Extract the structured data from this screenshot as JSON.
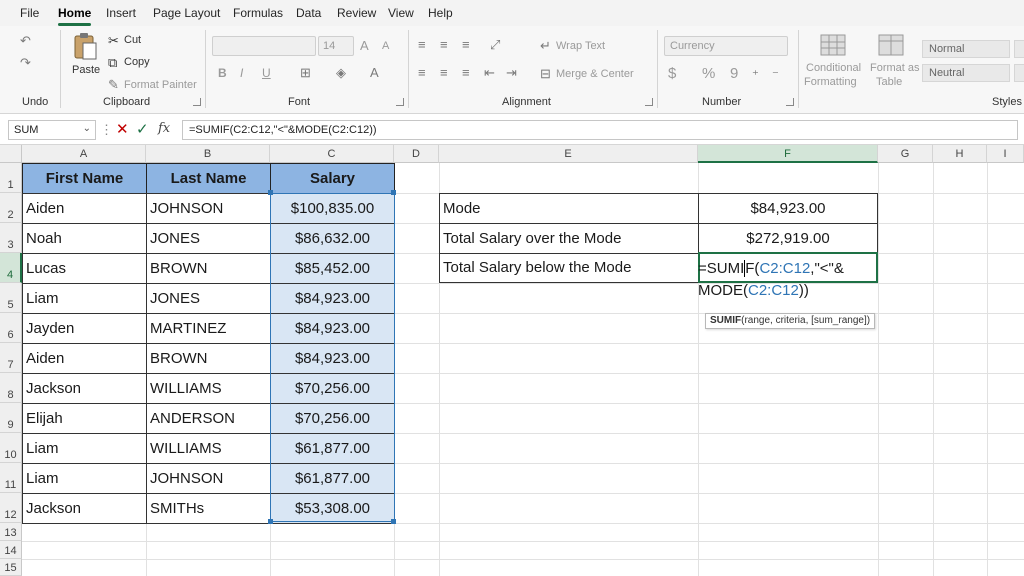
{
  "tabs": [
    "File",
    "Home",
    "Insert",
    "Page Layout",
    "Formulas",
    "Data",
    "Review",
    "View",
    "Help"
  ],
  "active_tab": "Home",
  "ribbon": {
    "undo_group": "Undo",
    "clipboard": {
      "paste": "Paste",
      "cut": "Cut",
      "copy": "Copy",
      "format_painter": "Format Painter",
      "label": "Clipboard"
    },
    "font": {
      "size": "14",
      "bold": "B",
      "italic": "I",
      "underline": "U",
      "grow": "A",
      "shrink": "A",
      "label": "Font"
    },
    "alignment": {
      "wrap": "Wrap Text",
      "merge": "Merge & Center",
      "label": "Alignment"
    },
    "number": {
      "format": "Currency",
      "dollar": "$",
      "percent": "%",
      "comma": "9",
      "label": "Number"
    },
    "styles": {
      "conditional": "Conditional",
      "formatting": "Formatting",
      "format_as": "Format as",
      "table": "Table",
      "normal": "Normal",
      "neutral": "Neutral",
      "label": "Styles"
    }
  },
  "formula_bar": {
    "name_box": "SUM",
    "fx": "fx",
    "formula": "=SUMIF(C2:C12,\"<\"&MODE(C2:C12))"
  },
  "columns": [
    "A",
    "B",
    "C",
    "D",
    "E",
    "F",
    "G",
    "H",
    "I"
  ],
  "rows": [
    "1",
    "2",
    "3",
    "4",
    "5",
    "6",
    "7",
    "8",
    "9",
    "10",
    "11",
    "12",
    "13",
    "14",
    "15"
  ],
  "table": {
    "headers": [
      "First Name",
      "Last Name",
      "Salary"
    ],
    "rows": [
      [
        "Aiden",
        "JOHNSON",
        "$100,835.00"
      ],
      [
        "Noah",
        "JONES",
        "$86,632.00"
      ],
      [
        "Lucas",
        "BROWN",
        "$85,452.00"
      ],
      [
        "Liam",
        "JONES",
        "$84,923.00"
      ],
      [
        "Jayden",
        "MARTINEZ",
        "$84,923.00"
      ],
      [
        "Aiden",
        "BROWN",
        "$84,923.00"
      ],
      [
        "Jackson",
        "WILLIAMS",
        "$70,256.00"
      ],
      [
        "Elijah",
        "ANDERSON",
        "$70,256.00"
      ],
      [
        "Liam",
        "WILLIAMS",
        "$61,877.00"
      ],
      [
        "Liam",
        "JOHNSON",
        "$61,877.00"
      ],
      [
        "Jackson",
        "SMITHs",
        "$53,308.00"
      ]
    ]
  },
  "summary": {
    "mode_label": "Mode",
    "mode_value": "$84,923.00",
    "over_label": "Total Salary over the Mode",
    "over_value": "$272,919.00",
    "below_label": "Total Salary below the Mode"
  },
  "editing": {
    "part1": "=SUMI",
    "part2": "F(",
    "ref1": "C2:C12",
    "part3": ",\"<\"&",
    "part4": "MODE(",
    "ref2": "C2:C12",
    "part5": "))"
  },
  "tooltip": {
    "func": "SUMIF",
    "args": "(range, criteria, [sum_range])"
  },
  "colors": {
    "accent": "#1e7145",
    "header_fill": "#8db4e2",
    "salary_fill": "#d9e6f4",
    "reference": "#2f75b5"
  }
}
